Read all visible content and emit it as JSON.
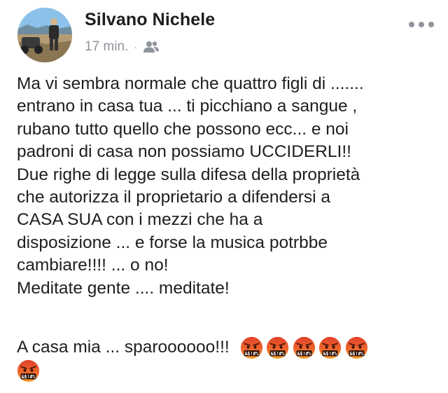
{
  "post": {
    "author_name": "Silvano Nichele",
    "time_ago": "17 min.",
    "separator": "·",
    "audience_icon": "friends-icon",
    "more_icon": "more-options-icon",
    "body_lines": [
      "Ma vi sembra normale che quattro figli di .......",
      "entrano in casa tua ... ti picchiano a sangue ,",
      "rubano tutto quello che possono ecc... e noi",
      "padroni di casa non possiamo UCCIDERLI!!",
      "Due righe di legge sulla difesa della proprietà",
      "che autorizza il proprietario a difendersi a",
      "CASA SUA con i mezzi che ha a",
      "disposizione ... e forse la musica potrbbe",
      "cambiare!!!! ... o no!",
      "Meditate gente .... meditate!"
    ],
    "final_line": "A casa mia ... sparoooooo!!!",
    "emoji_name": "face-with-symbols-on-mouth",
    "emoji_glyph_text": "&$!#%",
    "emoji_count": 6
  },
  "colors": {
    "text": "#1c1e21",
    "meta": "#90949c",
    "emoji_red": "#e0412a",
    "emoji_orange": "#f08a2b"
  }
}
